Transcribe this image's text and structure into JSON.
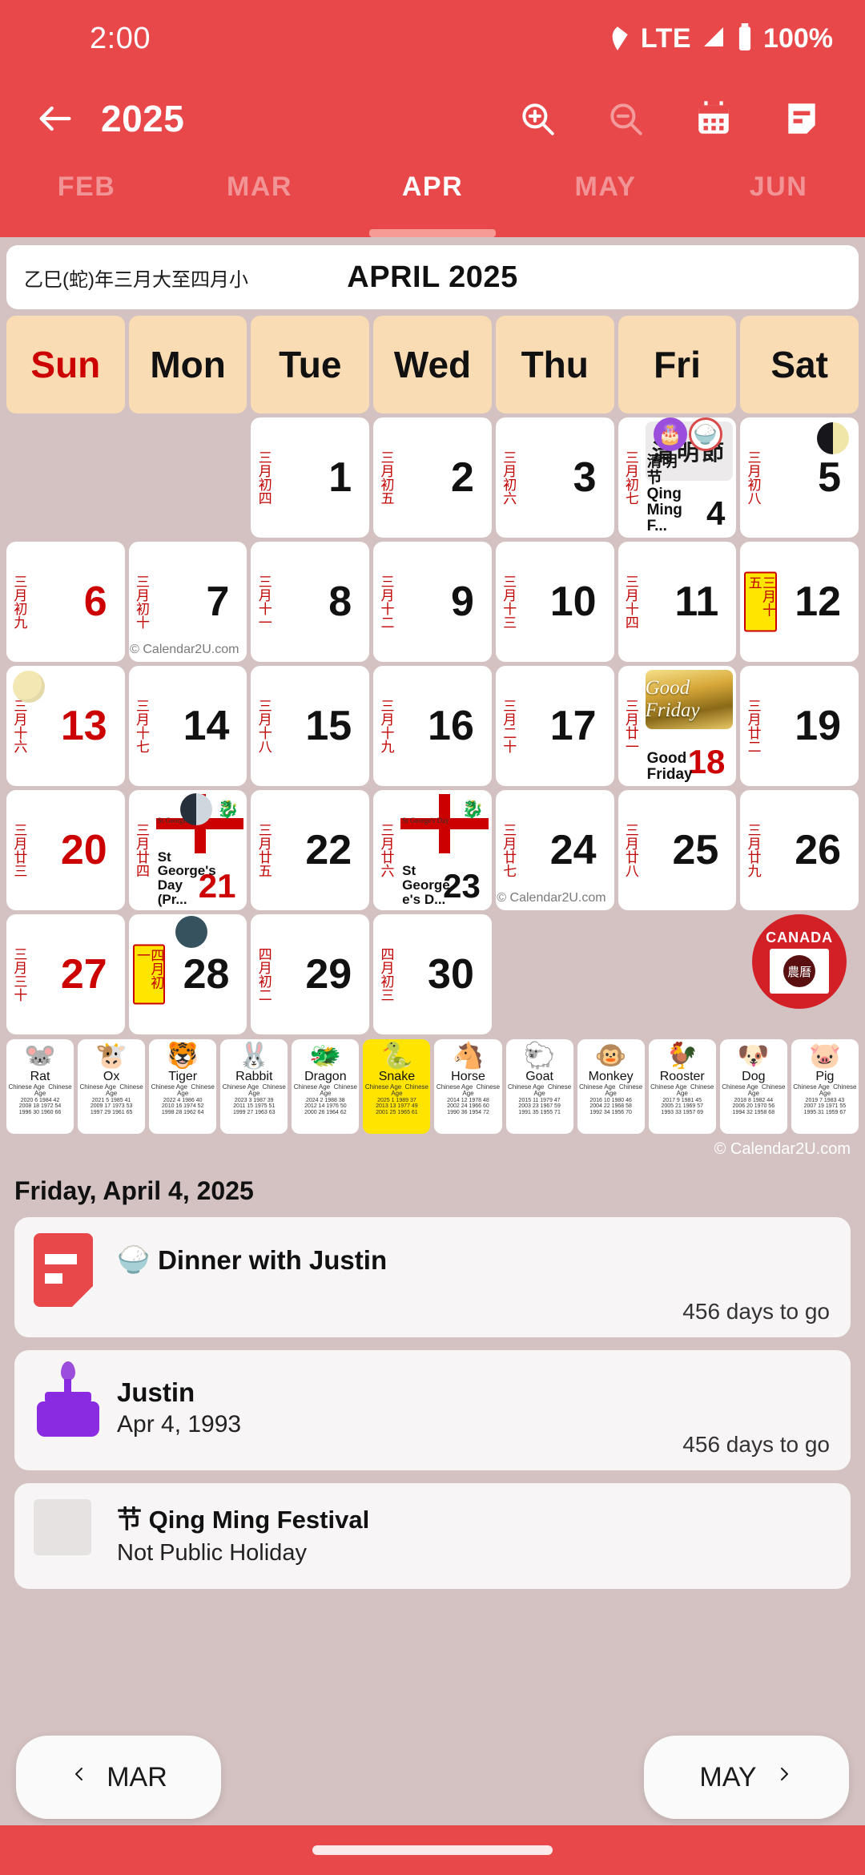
{
  "status": {
    "time": "2:00",
    "network": "LTE",
    "battery": "100%",
    "icons": [
      "wifi-icon",
      "signal-icon",
      "battery-icon"
    ]
  },
  "toolbar": {
    "back_icon": "back-arrow-icon",
    "title": "2025",
    "zoom_in_icon": "zoom-in-icon",
    "zoom_out_icon": "zoom-out-icon",
    "calendar_icon": "calendar-icon",
    "notes_icon": "notes-icon"
  },
  "tabs": [
    {
      "label": "FEB",
      "active": false
    },
    {
      "label": "MAR",
      "active": false
    },
    {
      "label": "APR",
      "active": true
    },
    {
      "label": "MAY",
      "active": false
    },
    {
      "label": "JUN",
      "active": false
    }
  ],
  "month_header": {
    "lunar_year": "乙巳(蛇)年三月大至四月小",
    "title": "APRIL 2025"
  },
  "weekdays": [
    "Sun",
    "Mon",
    "Tue",
    "Wed",
    "Thu",
    "Fri",
    "Sat"
  ],
  "weeks": [
    [
      {
        "empty": true
      },
      {
        "empty": true
      },
      {
        "num": "1",
        "lunar": "三月初四"
      },
      {
        "num": "2",
        "lunar": "三月初五"
      },
      {
        "num": "3",
        "lunar": "三月初六"
      },
      {
        "num": "4",
        "lunar": "三月初七",
        "event": "清明节 Qing Ming F...",
        "event_image": "qingming-banner",
        "badges": [
          "cake-icon",
          "bowl-icon"
        ]
      },
      {
        "num": "5",
        "lunar": "三月初八",
        "moon": "last-quarter"
      }
    ],
    [
      {
        "num": "6",
        "lunar": "三月初九",
        "red": true
      },
      {
        "num": "7",
        "lunar": "三月初十",
        "watermark": "© Calendar2U.com"
      },
      {
        "num": "8",
        "lunar": "三月十一"
      },
      {
        "num": "9",
        "lunar": "三月十二"
      },
      {
        "num": "10",
        "lunar": "三月十三"
      },
      {
        "num": "11",
        "lunar": "三月十四"
      },
      {
        "num": "12",
        "lunar": "三月十五",
        "lunar_boxed": true
      }
    ],
    [
      {
        "num": "13",
        "lunar": "三月十六",
        "red": true,
        "moon": "full"
      },
      {
        "num": "14",
        "lunar": "三月十七"
      },
      {
        "num": "15",
        "lunar": "三月十八"
      },
      {
        "num": "16",
        "lunar": "三月十九"
      },
      {
        "num": "17",
        "lunar": "三月二十"
      },
      {
        "num": "18",
        "lunar": "三月廿一",
        "red": true,
        "event": "Good Friday",
        "event_image": "good-friday-banner"
      },
      {
        "num": "19",
        "lunar": "三月廿二"
      }
    ],
    [
      {
        "num": "20",
        "lunar": "三月廿三",
        "red": true
      },
      {
        "num": "21",
        "lunar": "三月廿四",
        "red": true,
        "event": "St George's Day (Pr...",
        "event_image": "st-george-flag",
        "moon": "first-quarter"
      },
      {
        "num": "22",
        "lunar": "三月廿五"
      },
      {
        "num": "23",
        "lunar": "三月廿六",
        "event": "St George e's D...",
        "event_image": "st-george-flag"
      },
      {
        "num": "24",
        "lunar": "三月廿七",
        "watermark": "© Calendar2U.com"
      },
      {
        "num": "25",
        "lunar": "三月廿八"
      },
      {
        "num": "26",
        "lunar": "三月廿九"
      }
    ],
    [
      {
        "num": "27",
        "lunar": "三月三十",
        "red": true
      },
      {
        "num": "28",
        "lunar": "四月初一",
        "lunar_boxed": true,
        "moon": "new"
      },
      {
        "num": "29",
        "lunar": "四月初二"
      },
      {
        "num": "30",
        "lunar": "四月初三"
      },
      {
        "empty": true
      },
      {
        "empty": true
      },
      {
        "badge": {
          "country": "CANADA",
          "label": "農曆"
        }
      }
    ]
  ],
  "zodiac": {
    "sub_label_left": "Chinese Age",
    "sub_label_right": "Chinese Age",
    "animals": [
      {
        "name": "Rat",
        "emoji": "🐭",
        "highlight": false,
        "nums": "2020  6 1984  42\n2008 18 1972  54\n1996 30 1960  66"
      },
      {
        "name": "Ox",
        "emoji": "🐮",
        "highlight": false,
        "nums": "2021  5 1985  41\n2009 17 1973  53\n1997 29 1961  65"
      },
      {
        "name": "Tiger",
        "emoji": "🐯",
        "highlight": false,
        "nums": "2022  4 1986  40\n2010 16 1974  52\n1998 28 1962  64"
      },
      {
        "name": "Rabbit",
        "emoji": "🐰",
        "highlight": false,
        "nums": "2023  3 1987  39\n2011 15 1975  51\n1999 27 1963  63"
      },
      {
        "name": "Dragon",
        "emoji": "🐲",
        "highlight": false,
        "nums": "2024  2 1988  38\n2012 14 1976  50\n2000 26 1964  62"
      },
      {
        "name": "Snake",
        "emoji": "🐍",
        "highlight": true,
        "nums": "2025  1 1989  37\n2013 13 1977  49\n2001 25 1965  61"
      },
      {
        "name": "Horse",
        "emoji": "🐴",
        "highlight": false,
        "nums": "2014 12 1978  48\n2002 24 1966  60\n1990 36 1954  72"
      },
      {
        "name": "Goat",
        "emoji": "🐑",
        "highlight": false,
        "nums": "2015 11 1979  47\n2003 23 1967  59\n1991 35 1955  71"
      },
      {
        "name": "Monkey",
        "emoji": "🐵",
        "highlight": false,
        "nums": "2016 10 1980  46\n2004 22 1968  58\n1992 34 1956  70"
      },
      {
        "name": "Rooster",
        "emoji": "🐓",
        "highlight": false,
        "nums": "2017  9 1981  45\n2005 21 1969  57\n1993 33 1957  69"
      },
      {
        "name": "Dog",
        "emoji": "🐶",
        "highlight": false,
        "nums": "2018  8 1982  44\n2006 20 1970  56\n1994 32 1958  68"
      },
      {
        "name": "Pig",
        "emoji": "🐷",
        "highlight": false,
        "nums": "2019  7 1983  43\n2007 19 1971  55\n1995 31 1959  67"
      }
    ]
  },
  "credit": "© Calendar2U.com",
  "events": {
    "date_header": "Friday, April 4, 2025",
    "items": [
      {
        "icon": "note-icon",
        "emoji": "🍚",
        "title": "Dinner with Justin",
        "subtitle": "",
        "countdown": "456 days to go"
      },
      {
        "icon": "birthday-cake-icon",
        "emoji": "",
        "title": "Justin",
        "subtitle": "Apr 4, 1993",
        "countdown": "456 days to go"
      },
      {
        "icon": "holiday-icon",
        "emoji": "",
        "title": "节 Qing Ming Festival",
        "subtitle": "Not Public Holiday",
        "countdown": ""
      }
    ]
  },
  "bottom_nav": {
    "prev_label": "MAR",
    "prev_icon": "chevron-left-icon",
    "next_label": "MAY",
    "next_icon": "chevron-right-icon"
  },
  "colors": {
    "brand_red": "#e8484a",
    "page_bg": "#d4c2c2",
    "header_peach": "#fadcb4",
    "lunar_red": "#cc0000",
    "highlight_yellow": "#ffe400"
  }
}
